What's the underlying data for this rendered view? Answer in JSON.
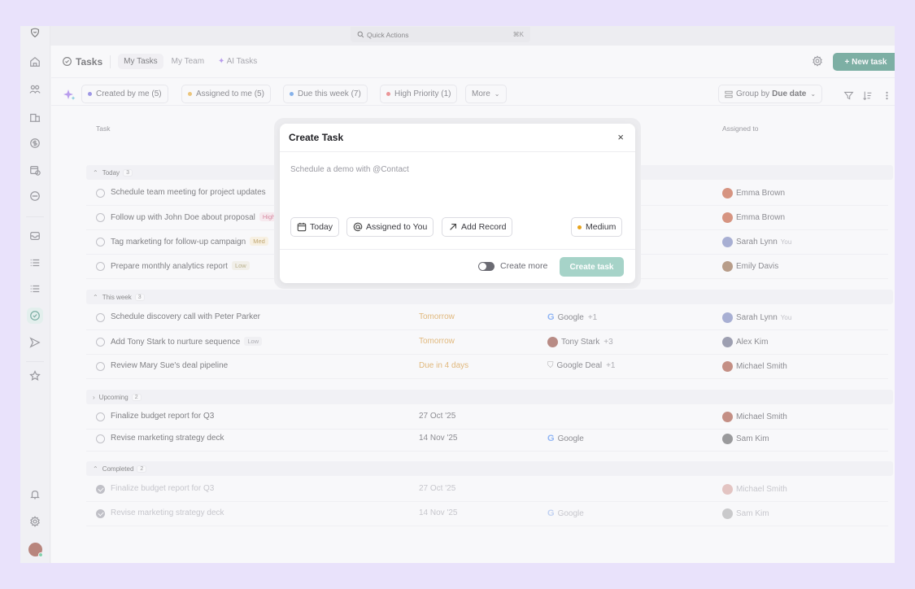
{
  "quick_actions": {
    "label": "Quick Actions",
    "shortcut": "⌘K"
  },
  "header": {
    "title": "Tasks",
    "tabs": [
      "My Tasks",
      "My Team",
      "AI Tasks"
    ],
    "new_task": "+ New task"
  },
  "filters": {
    "chips": [
      {
        "label": "Created by me (5)",
        "color": "#5b4fd9"
      },
      {
        "label": "Assigned to me (5)",
        "color": "#e8a31b"
      },
      {
        "label": "Due this week (7)",
        "color": "#2f7fe0"
      },
      {
        "label": "High Priority (1)",
        "color": "#e84d4d"
      }
    ],
    "more": "More",
    "group_by_prefix": "Group by",
    "group_by_value": "Due date"
  },
  "columns": {
    "task": "Task",
    "assigned": "Assigned to"
  },
  "groups": {
    "today": {
      "label": "Today",
      "count": "3"
    },
    "this_week": {
      "label": "This week",
      "count": "3"
    },
    "upcoming": {
      "label": "Upcoming",
      "count": "2"
    },
    "completed": {
      "label": "Completed",
      "count": "2"
    }
  },
  "rows": [
    {
      "name": "Schedule team meeting for project updates",
      "tag": "",
      "due": "",
      "record": "",
      "record_more": "",
      "assignee": "Emma Brown",
      "you": ""
    },
    {
      "name": "Follow up with John Doe about proposal",
      "tag": "High",
      "due": "",
      "record": "",
      "record_more": "",
      "assignee": "Emma Brown",
      "you": ""
    },
    {
      "name": "Tag marketing for follow-up campaign",
      "tag": "Med",
      "due": "",
      "record": "",
      "record_more": "",
      "assignee": "Sarah Lynn",
      "you": "You"
    },
    {
      "name": "Prepare monthly analytics report",
      "tag": "Low",
      "due": "",
      "record": "",
      "record_more": "",
      "assignee": "Emily Davis",
      "you": ""
    },
    {
      "name": "Schedule discovery call with Peter Parker",
      "tag": "",
      "due": "Tomorrow",
      "record": "Google",
      "record_more": "+1",
      "assignee": "Sarah Lynn",
      "you": "You"
    },
    {
      "name": "Add Tony Stark to nurture sequence",
      "tag": "Low",
      "due": "Tomorrow",
      "record": "Tony Stark",
      "record_more": "+3",
      "assignee": "Alex Kim",
      "you": ""
    },
    {
      "name": "Review Mary Sue's deal pipeline",
      "tag": "",
      "due": "Due in 4 days",
      "record": "Google Deal",
      "record_more": "+1",
      "assignee": "Michael Smith",
      "you": ""
    },
    {
      "name": "Finalize budget report for Q3",
      "tag": "",
      "due": "27 Oct '25",
      "record": "",
      "record_more": "",
      "assignee": "Michael Smith",
      "you": ""
    },
    {
      "name": "Revise marketing strategy deck",
      "tag": "",
      "due": "14 Nov '25",
      "record": "Google",
      "record_more": "",
      "assignee": "Sam Kim",
      "you": ""
    },
    {
      "name": "Finalize budget report for Q3",
      "tag": "",
      "due": "27 Oct '25",
      "record": "",
      "record_more": "",
      "assignee": "Michael Smith",
      "you": ""
    },
    {
      "name": "Revise marketing strategy deck",
      "tag": "",
      "due": "14 Nov '25",
      "record": "Google",
      "record_more": "",
      "assignee": "Sam Kim",
      "you": ""
    }
  ],
  "modal": {
    "title": "Create Task",
    "close": "×",
    "placeholder": "Schedule a demo with @Contact",
    "today": "Today",
    "assigned": "Assigned to You",
    "add_record": "Add Record",
    "priority": "Medium",
    "create_more": "Create more",
    "create_task": "Create task"
  }
}
